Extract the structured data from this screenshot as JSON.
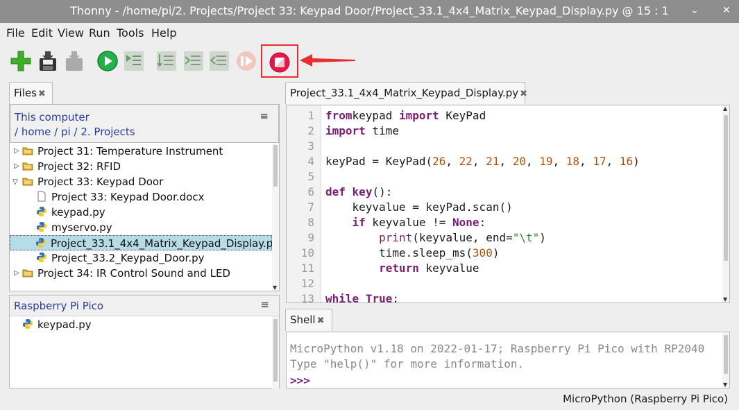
{
  "window": {
    "title": "Thonny  -  /home/pi/2. Projects/Project 33: Keypad Door/Project_33.1_4x4_Matrix_Keypad_Display.py  @  15 : 1",
    "minimize_glyph": "⌄",
    "close_glyph": "✕"
  },
  "menu": [
    "File",
    "Edit",
    "View",
    "Run",
    "Tools",
    "Help"
  ],
  "toolbar": {
    "icons": [
      "new-file-icon",
      "save-icon",
      "load-icon",
      "run-icon",
      "debug-icon",
      "step-over-icon",
      "step-into-icon",
      "step-out-icon",
      "resume-icon",
      "stop-icon"
    ],
    "highlight_color": "#e62e2e"
  },
  "files_panel": {
    "tab_label": "Files",
    "tab_close": "✖",
    "this_computer": "This computer",
    "breadcrumb": [
      "/",
      "home",
      "/",
      "pi",
      "/",
      "2. Projects"
    ],
    "menu_glyph": "≡",
    "tree": [
      {
        "label": "Project 31: Temperature Instrument",
        "type": "folder",
        "expanded": false
      },
      {
        "label": "Project 32: RFID",
        "type": "folder",
        "expanded": false
      },
      {
        "label": "Project 33: Keypad Door",
        "type": "folder",
        "expanded": true
      },
      {
        "label": "Project 33: Keypad Door.docx",
        "type": "file"
      },
      {
        "label": "keypad.py",
        "type": "python"
      },
      {
        "label": "myservo.py",
        "type": "python"
      },
      {
        "label": "Project_33.1_4x4_Matrix_Keypad_Display.p",
        "type": "python",
        "selected": true
      },
      {
        "label": "Project_33.2_Keypad_Door.py",
        "type": "python"
      },
      {
        "label": "Project 34: IR Control Sound and LED",
        "type": "folder",
        "expanded": false
      }
    ],
    "pico_title": "Raspberry Pi Pico",
    "pico_files": [
      "keypad.py"
    ]
  },
  "editor": {
    "tab_label": "Project_33.1_4x4_Matrix_Keypad_Display.py",
    "tab_close": "✖",
    "line_numbers": [
      "1",
      "2",
      "3",
      "4",
      "5",
      "6",
      "7",
      "8",
      "9",
      "10",
      "11",
      "12",
      "13"
    ],
    "lines": [
      [
        [
          "kw",
          "from"
        ],
        [
          "",
          "keypad "
        ],
        [
          "kw",
          "import"
        ],
        [
          "",
          " KeyPad"
        ]
      ],
      [
        [
          "kw",
          "import"
        ],
        [
          "",
          " time"
        ]
      ],
      [],
      [
        [
          "",
          "keyPad = KeyPad("
        ],
        [
          "num",
          "26"
        ],
        [
          "",
          ", "
        ],
        [
          "num",
          "22"
        ],
        [
          "",
          ", "
        ],
        [
          "num",
          "21"
        ],
        [
          "",
          ", "
        ],
        [
          "num",
          "20"
        ],
        [
          "",
          ", "
        ],
        [
          "num",
          "19"
        ],
        [
          "",
          ", "
        ],
        [
          "num",
          "18"
        ],
        [
          "",
          ", "
        ],
        [
          "num",
          "17"
        ],
        [
          "",
          ", "
        ],
        [
          "num",
          "16"
        ],
        [
          "",
          ")"
        ]
      ],
      [],
      [
        [
          "kw",
          "def"
        ],
        [
          "",
          " "
        ],
        [
          "kw",
          "key"
        ],
        [
          "",
          "():"
        ]
      ],
      [
        [
          "",
          "    keyvalue = keyPad.scan()"
        ]
      ],
      [
        [
          "",
          "    "
        ],
        [
          "kw",
          "if"
        ],
        [
          "",
          " keyvalue != "
        ],
        [
          "kw",
          "None"
        ],
        [
          "",
          ":"
        ]
      ],
      [
        [
          "",
          "        "
        ],
        [
          "bi",
          "print"
        ],
        [
          "",
          "(keyvalue, end="
        ],
        [
          "str",
          "\"\\t\""
        ],
        [
          "",
          ")"
        ]
      ],
      [
        [
          "",
          "        time.sleep_ms("
        ],
        [
          "num",
          "300"
        ],
        [
          "",
          ")"
        ]
      ],
      [
        [
          "",
          "        "
        ],
        [
          "kw",
          "return"
        ],
        [
          "",
          " keyvalue"
        ]
      ],
      [],
      [
        [
          "kw",
          "while"
        ],
        [
          "",
          " "
        ],
        [
          "kw",
          "True"
        ],
        [
          "",
          ":"
        ]
      ]
    ]
  },
  "shell": {
    "tab_label": "Shell",
    "tab_close": "✖",
    "line1": "MicroPython v1.18 on 2022-01-17; Raspberry Pi Pico with RP2040",
    "line2": "Type \"help()\" for more information.",
    "prompt": ">>>"
  },
  "status": {
    "interpreter": "MicroPython (Raspberry Pi Pico)"
  }
}
